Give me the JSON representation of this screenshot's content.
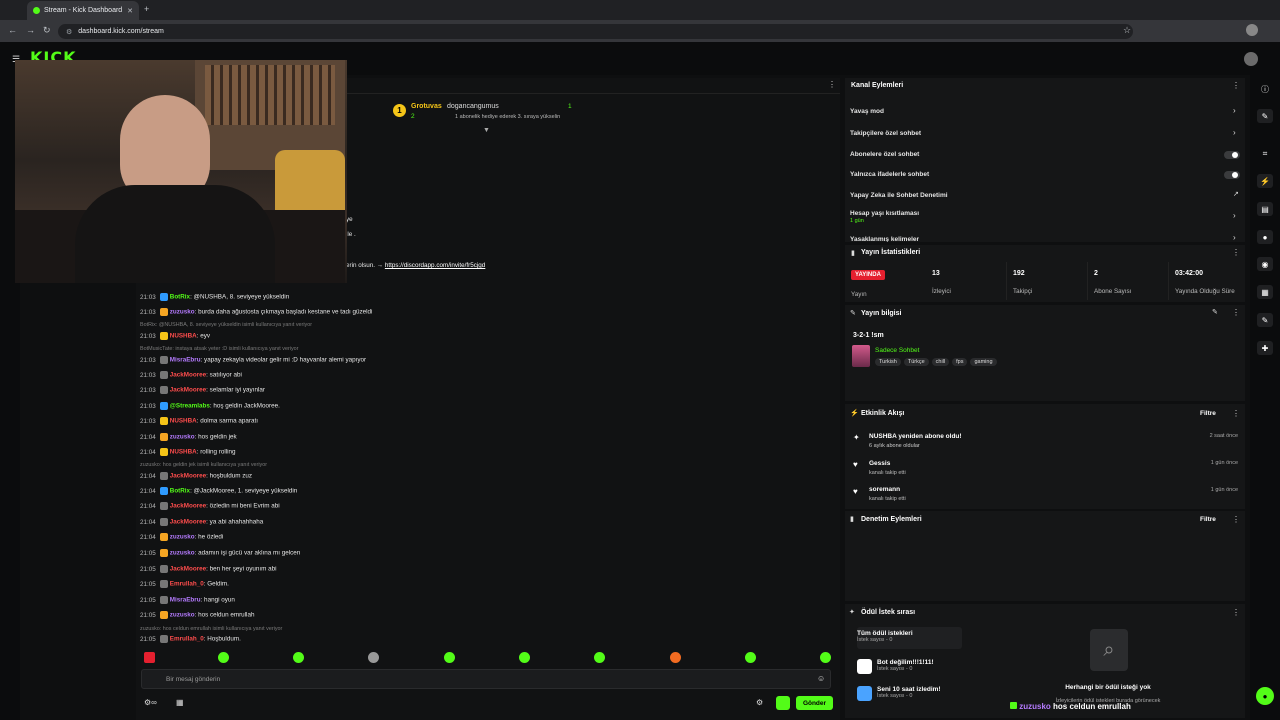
{
  "browser": {
    "tab_title": "Stream - Kick Dashboard",
    "url": "dashboard.kick.com/stream"
  },
  "app": {
    "logo_text": "KICK"
  },
  "chat": {
    "gift": {
      "user": "Grotuvas",
      "count": "2",
      "recipient": "dogancangumus",
      "recipient_count": "1",
      "subtext": "1 abonelik hediye ederek 3. sıraya yükselin"
    },
    "truncated_1": "ye",
    "truncated_2": "ile .",
    "discord_prefix": "erin olsun. →",
    "discord_link": "https://discordapp.com/invite/fr5cjgd",
    "messages": [
      {
        "time": "21:03",
        "user": "BotRix",
        "text": ": @NUSHBA, 8. seviyeye yükseldin",
        "color": "#53fc18"
      },
      {
        "time": "21:03",
        "user": "zuzusko",
        "text": ": burda daha ağustosta çıkmaya başladı kestane ve tadı güzeldi",
        "color": "#b57bff"
      },
      {
        "reply": "BotRix: @NUSHBA, 8. seviyeye yükseldin isimli kullanıcıya yanıt veriyor"
      },
      {
        "time": "21:03",
        "user": "NUSHBA",
        "text": ": eyv",
        "color": "#ff4d4d"
      },
      {
        "reply": "BotMusicTate: instaya atsak yeter :D isimli kullanıcıya yanıt veriyor"
      },
      {
        "time": "21:03",
        "user": "MisraEbru",
        "text": ": yapay zekayla videolar gelir mi :D hayvanlar alemi yapıyor",
        "color": "#b57bff"
      },
      {
        "time": "21:03",
        "user": "JackMooree",
        "text": ": satılıyor abi",
        "color": "#ff4d4d"
      },
      {
        "time": "21:03",
        "user": "JackMooree",
        "text": ": selamlar iyi yayınlar",
        "color": "#ff4d4d"
      },
      {
        "time": "21:03",
        "user": "@Streamlabs",
        "text": ": hoş geldin JackMooree.",
        "color": "#53fc18"
      },
      {
        "time": "21:03",
        "user": "NUSHBA",
        "text": ": dolma sarma aparatı",
        "color": "#ff4d4d"
      },
      {
        "time": "21:04",
        "user": "zuzusko",
        "text": ": hos geldin jek",
        "color": "#b57bff"
      },
      {
        "time": "21:04",
        "user": "NUSHBA",
        "text": ": rolling rolling",
        "color": "#ff4d4d"
      },
      {
        "reply": "zuzusko: hos geldin jek isimli kullanıcıya yanıt veriyor"
      },
      {
        "time": "21:04",
        "user": "JackMooree",
        "text": ": hoşbuldum zuz",
        "color": "#ff4d4d"
      },
      {
        "time": "21:04",
        "user": "BotRix",
        "text": ": @JackMooree, 1. seviyeye yükseldin",
        "color": "#53fc18"
      },
      {
        "time": "21:04",
        "user": "JackMooree",
        "text": ": özledin mi beni Evrim abi",
        "color": "#ff4d4d"
      },
      {
        "time": "21:04",
        "user": "JackMooree",
        "text": ": ya abi ahahahhaha",
        "color": "#ff4d4d"
      },
      {
        "time": "21:04",
        "user": "zuzusko",
        "text": ": he özledi",
        "color": "#b57bff"
      },
      {
        "time": "21:05",
        "user": "zuzusko",
        "text": ": adamın işi gücü var aklına mı gelcen",
        "color": "#b57bff"
      },
      {
        "time": "21:05",
        "user": "JackMooree",
        "text": ": ben her şeyi oyunım abi",
        "color": "#ff4d4d"
      },
      {
        "time": "21:05",
        "user": "Emrullah_0",
        "text": ": Geldim.",
        "color": "#ff4d4d"
      },
      {
        "time": "21:05",
        "user": "MisraEbru",
        "text": ": hangi oyun",
        "color": "#b57bff"
      },
      {
        "time": "21:05",
        "user": "zuzusko",
        "text": ": hos celdun emrullah",
        "color": "#b57bff"
      },
      {
        "reply": "zuzusko: hos celdun emrullah isimli kullanıcıya yanıt veriyor"
      },
      {
        "time": "21:05",
        "user": "Emrullah_0",
        "text": ": Hoşbuldum.",
        "color": "#ff4d4d"
      }
    ],
    "input_placeholder": "Bir mesaj gönderin",
    "send_label": "Gönder"
  },
  "channel_actions": {
    "title": "Kanal Eylemleri",
    "items": [
      {
        "label": "Yavaş mod"
      },
      {
        "label": "Takipçilere özel sohbet"
      },
      {
        "label": "Abonelere özel sohbet"
      },
      {
        "label": "Yalnızca ifadelerle sohbet"
      },
      {
        "label": "Yapay Zeka ile Sohbet Denetimi"
      },
      {
        "label": "Hesap yaşı kısıtlaması",
        "sub": "1 gün"
      },
      {
        "label": "Yasaklanmış kelimeler"
      }
    ]
  },
  "stream_stats": {
    "title": "Yayın İstatistikleri",
    "live_badge": "YAYINDA",
    "live_label": "Yayın",
    "stats": [
      {
        "value": "13",
        "label": "İzleyici"
      },
      {
        "value": "192",
        "label": "Takipçi"
      },
      {
        "value": "2",
        "label": "Abone Sayısı"
      },
      {
        "value": "03:42:00",
        "label": "Yayında Olduğu Süre"
      }
    ]
  },
  "stream_info": {
    "title": "Yayın bilgisi",
    "stream_title": "3-2-1 !sm",
    "category": "Sadece Sohbet",
    "tags": [
      "Turkish",
      "Türkçe",
      "chill",
      "fps",
      "gaming"
    ]
  },
  "activity": {
    "title": "Etkinlik Akışı",
    "filter": "Filtre",
    "events": [
      {
        "name": "NUSHBA yeniden abone oldu!",
        "sub": "6 aylık abone oldular",
        "time": "2 saat önce"
      },
      {
        "name": "Gessis",
        "sub": "kanalı takip etti",
        "time": "1 gün önce"
      },
      {
        "name": "soremann",
        "sub": "kanalı takip etti",
        "time": "1 gün önce"
      }
    ]
  },
  "moderation": {
    "title": "Denetim Eylemleri",
    "filter": "Filtre"
  },
  "rewards": {
    "title": "Ödül İstek sırası",
    "items": [
      {
        "name": "Tüm ödül istekleri",
        "count": "İstek sayısı - 0"
      },
      {
        "name": "Bot değilim!!!1!11!",
        "count": "İstek sayısı - 0"
      },
      {
        "name": "Seni 10 saat izledim!",
        "count": "İstek sayısı - 0"
      }
    ],
    "empty_title": "Herhangi bir ödül isteği yok",
    "empty_sub": "İzleyicilerin ödül istekleri burada görünecek"
  },
  "overlay": {
    "user": "zuzusko",
    "text": "hos celdun emrullah"
  }
}
